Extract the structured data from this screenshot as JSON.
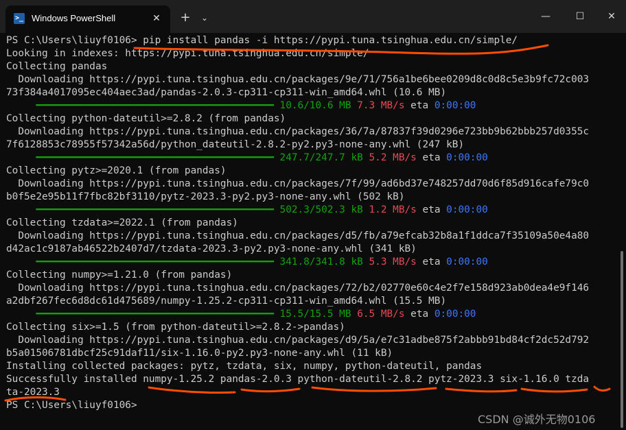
{
  "window": {
    "tab_title": "Windows PowerShell",
    "tab_icon_glyph": ">_",
    "close_tab_glyph": "✕",
    "new_tab_glyph": "+",
    "dropdown_glyph": "⌄",
    "minimize_glyph": "—",
    "maximize_glyph": "☐",
    "close_glyph": "✕"
  },
  "terminal": {
    "lines": [
      [
        {
          "t": "PS C:\\Users\\liuyf0106> pip install pandas -i https://pypi.tuna.tsinghua.edu.cn/simple/"
        }
      ],
      [
        {
          "t": "Looking in indexes: https://pypi.tuna.tsinghua.edu.cn/simple/"
        }
      ],
      [
        {
          "t": "Collecting pandas"
        }
      ],
      [
        {
          "t": "  Downloading https://pypi.tuna.tsinghua.edu.cn/packages/9e/71/756a1be6bee0209d8c0d8c5e3b9fc72c003"
        }
      ],
      [
        {
          "t": "73f384a4017095ec404aec3ad/pandas-2.0.3-cp311-cp311-win_amd64.whl (10.6 MB)"
        }
      ],
      [
        {
          "t": "     ━━━━━━━━━━━━━━━━━━━━━━━━━━━━━━━━━━━━━━━━ 10.6/10.6 MB",
          "c": "bar"
        },
        {
          "t": " "
        },
        {
          "t": "7.3 MB/s",
          "c": "spd"
        },
        {
          "t": " eta "
        },
        {
          "t": "0:00:00",
          "c": "eta"
        }
      ],
      [
        {
          "t": "Collecting python-dateutil>=2.8.2 (from pandas)"
        }
      ],
      [
        {
          "t": "  Downloading https://pypi.tuna.tsinghua.edu.cn/packages/36/7a/87837f39d0296e723bb9b62bbb257d0355c"
        }
      ],
      [
        {
          "t": "7f6128853c78955f57342a56d/python_dateutil-2.8.2-py2.py3-none-any.whl (247 kB)"
        }
      ],
      [
        {
          "t": "     ━━━━━━━━━━━━━━━━━━━━━━━━━━━━━━━━━━━━━━━━ 247.7/247.7 kB",
          "c": "bar"
        },
        {
          "t": " "
        },
        {
          "t": "5.2 MB/s",
          "c": "spd"
        },
        {
          "t": " eta "
        },
        {
          "t": "0:00:00",
          "c": "eta"
        }
      ],
      [
        {
          "t": "Collecting pytz>=2020.1 (from pandas)"
        }
      ],
      [
        {
          "t": "  Downloading https://pypi.tuna.tsinghua.edu.cn/packages/7f/99/ad6bd37e748257dd70d6f85d916cafe79c0"
        }
      ],
      [
        {
          "t": "b0f5e2e95b11f7fbc82bf3110/pytz-2023.3-py2.py3-none-any.whl (502 kB)"
        }
      ],
      [
        {
          "t": "     ━━━━━━━━━━━━━━━━━━━━━━━━━━━━━━━━━━━━━━━━ 502.3/502.3 kB",
          "c": "bar"
        },
        {
          "t": " "
        },
        {
          "t": "1.2 MB/s",
          "c": "spd"
        },
        {
          "t": " eta "
        },
        {
          "t": "0:00:00",
          "c": "eta"
        }
      ],
      [
        {
          "t": "Collecting tzdata>=2022.1 (from pandas)"
        }
      ],
      [
        {
          "t": "  Downloading https://pypi.tuna.tsinghua.edu.cn/packages/d5/fb/a79efcab32b8a1f1ddca7f35109a50e4a80"
        }
      ],
      [
        {
          "t": "d42ac1c9187ab46522b2407d7/tzdata-2023.3-py2.py3-none-any.whl (341 kB)"
        }
      ],
      [
        {
          "t": "     ━━━━━━━━━━━━━━━━━━━━━━━━━━━━━━━━━━━━━━━━ 341.8/341.8 kB",
          "c": "bar"
        },
        {
          "t": " "
        },
        {
          "t": "5.3 MB/s",
          "c": "spd"
        },
        {
          "t": " eta "
        },
        {
          "t": "0:00:00",
          "c": "eta"
        }
      ],
      [
        {
          "t": "Collecting numpy>=1.21.0 (from pandas)"
        }
      ],
      [
        {
          "t": "  Downloading https://pypi.tuna.tsinghua.edu.cn/packages/72/b2/02770e60c4e2f7e158d923ab0dea4e9f146"
        }
      ],
      [
        {
          "t": "a2dbf267fec6d8dc61d475689/numpy-1.25.2-cp311-cp311-win_amd64.whl (15.5 MB)"
        }
      ],
      [
        {
          "t": "     ━━━━━━━━━━━━━━━━━━━━━━━━━━━━━━━━━━━━━━━━ 15.5/15.5 MB",
          "c": "bar"
        },
        {
          "t": " "
        },
        {
          "t": "6.5 MB/s",
          "c": "spd"
        },
        {
          "t": " eta "
        },
        {
          "t": "0:00:00",
          "c": "eta"
        }
      ],
      [
        {
          "t": "Collecting six>=1.5 (from python-dateutil>=2.8.2->pandas)"
        }
      ],
      [
        {
          "t": "  Downloading https://pypi.tuna.tsinghua.edu.cn/packages/d9/5a/e7c31adbe875f2abbb91bd84cf2dc52d792"
        }
      ],
      [
        {
          "t": "b5a01506781dbcf25c91daf11/six-1.16.0-py2.py3-none-any.whl (11 kB)"
        }
      ],
      [
        {
          "t": "Installing collected packages: pytz, tzdata, six, numpy, python-dateutil, pandas"
        }
      ],
      [
        {
          "t": "Successfully installed numpy-1.25.2 pandas-2.0.3 python-dateutil-2.8.2 pytz-2023.3 six-1.16.0 tzda"
        }
      ],
      [
        {
          "t": "ta-2023.3"
        }
      ],
      [
        {
          "t": "PS C:\\Users\\liuyf0106>"
        }
      ]
    ]
  },
  "colors": {
    "terminal_bg": "#0c0c0c",
    "text": "#cccccc",
    "progress": "#13a10e",
    "speed": "#e74856",
    "eta": "#3b78ff",
    "annotation": "#ff4d00"
  },
  "watermark": "CSDN @诚外无物0106"
}
